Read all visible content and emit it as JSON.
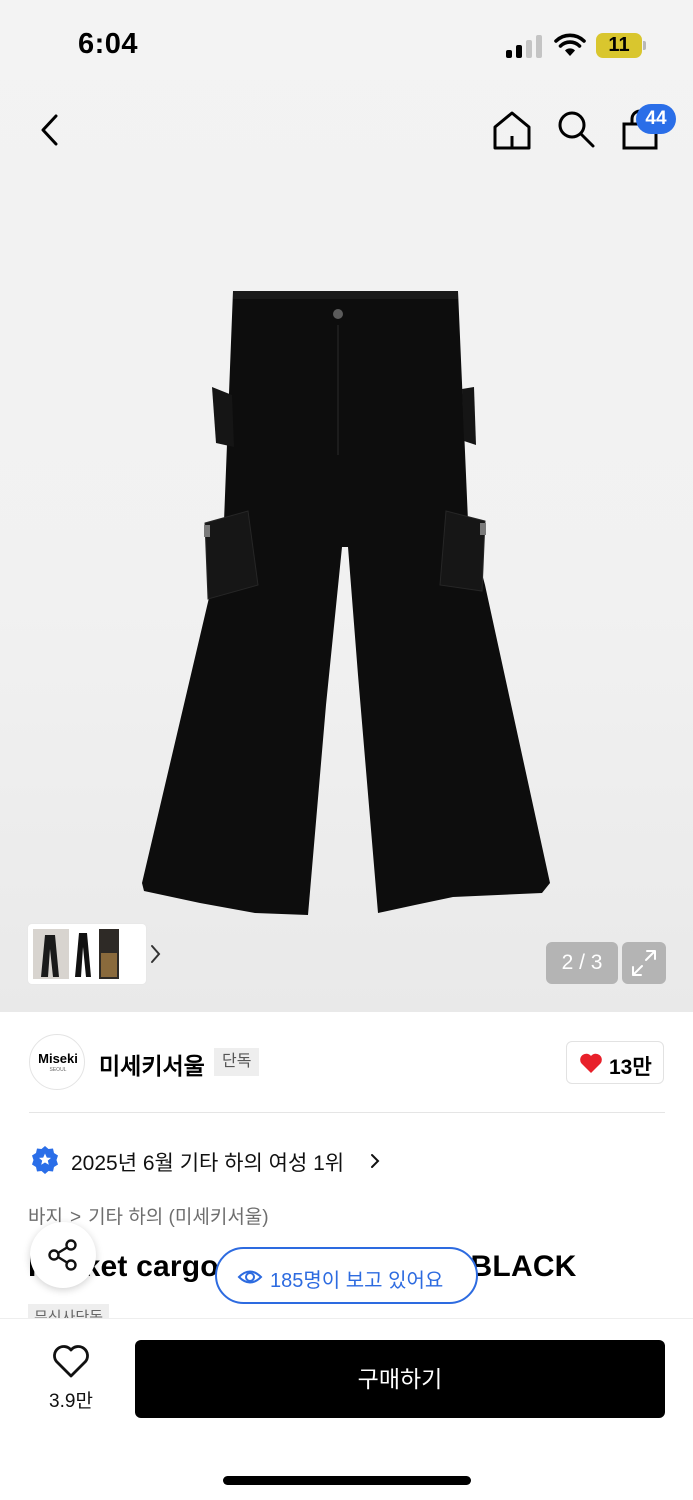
{
  "status_bar": {
    "time": "6:04",
    "battery": "11"
  },
  "header": {
    "cart_count": "44"
  },
  "gallery": {
    "page_indicator": "2 / 3"
  },
  "brand": {
    "logo_text": "Miseki",
    "logo_subtext": "SEOUL",
    "name": "미세키서울",
    "badge": "단독",
    "like_count": "13만"
  },
  "ranking": {
    "text": "2025년 6월 기타 하의 여성 1위"
  },
  "breadcrumb": [
    "바지",
    "기타 하의 (미세키서울)"
  ],
  "product": {
    "title": "Pocket cargo boots cut pants_BLACK",
    "tag": "무신사단독"
  },
  "viewers": {
    "text": "185명이 보고 있어요"
  },
  "bottom_bar": {
    "wish_count": "3.9만",
    "buy_label": "구매하기"
  },
  "colors": {
    "accent_blue": "#2d6be0",
    "badge_blue": "#2a6ee8",
    "heart_red": "#e8202a",
    "battery_yellow": "#d9c62e"
  }
}
